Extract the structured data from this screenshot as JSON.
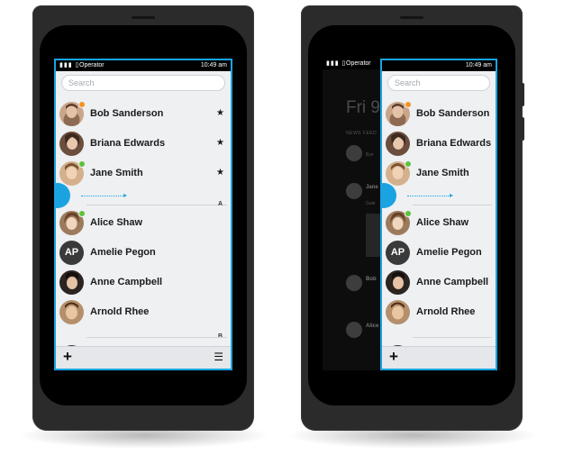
{
  "status": {
    "icons": "▮▮▮ ▯",
    "operator": "Operator",
    "time": "10:49 am"
  },
  "search": {
    "placeholder": "Search"
  },
  "contacts": [
    {
      "name": "Bob Sanderson",
      "starred": "★",
      "presence": "orange"
    },
    {
      "name": "Briana Edwards",
      "starred": "★",
      "presence": ""
    },
    {
      "name": "Jane Smith",
      "starred": "★",
      "presence": "green"
    },
    {
      "name": "Alice Shaw",
      "starred": "",
      "presence": "green"
    },
    {
      "name": "Amelie Pegon",
      "starred": "",
      "presence": "",
      "initials": "AP"
    },
    {
      "name": "Anne Campbell",
      "starred": "",
      "presence": ""
    },
    {
      "name": "Arnold Rhee",
      "starred": "",
      "presence": ""
    }
  ],
  "sections": {
    "a": "A",
    "b": "B"
  },
  "toolbar": {
    "add": "+",
    "menu": "☰"
  },
  "feed": {
    "day": "Fri 9",
    "label": "NEWS FEED",
    "items": [
      {
        "name": "Jane",
        "text": "Bye"
      },
      {
        "name": "Jane",
        "text": "Gale"
      },
      {
        "name": "Bob",
        "text": ""
      },
      {
        "name": "Alice",
        "text": ""
      }
    ]
  },
  "colors": {
    "accent": "#1aa3e0",
    "phone_body": "#2b2b2c",
    "list_bg": "#eef0f2",
    "presence_online": "#5cc33b",
    "presence_away": "#f3931f"
  }
}
